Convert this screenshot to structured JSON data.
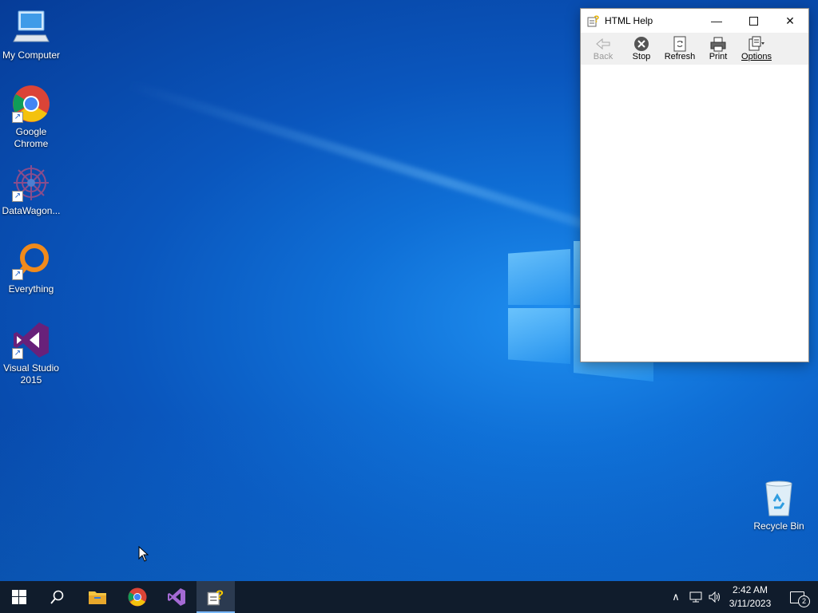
{
  "desktop": {
    "icons": [
      {
        "label": "My Computer",
        "icon": "computer-icon"
      },
      {
        "label": "Google Chrome",
        "icon": "chrome-icon"
      },
      {
        "label": "DataWagon...",
        "icon": "datawagon-icon"
      },
      {
        "label": "Everything",
        "icon": "everything-search-icon"
      },
      {
        "label": "Visual Studio 2015",
        "icon": "visual-studio-icon"
      },
      {
        "label": "Recycle Bin",
        "icon": "recycle-bin-icon"
      }
    ]
  },
  "window": {
    "title": "HTML Help",
    "toolbar": [
      {
        "label": "Back",
        "icon": "back-arrow-icon",
        "enabled": false
      },
      {
        "label": "Stop",
        "icon": "stop-icon",
        "enabled": true
      },
      {
        "label": "Refresh",
        "icon": "refresh-icon",
        "enabled": true
      },
      {
        "label": "Print",
        "icon": "printer-icon",
        "enabled": true
      },
      {
        "label": "Options",
        "icon": "options-icon",
        "enabled": true
      }
    ]
  },
  "taskbar": {
    "apps": [
      "start-icon",
      "search-icon",
      "file-explorer-icon",
      "chrome-icon",
      "visual-studio-icon",
      "html-help-icon"
    ],
    "clock": {
      "time": "2:42 AM",
      "date": "3/11/2023"
    },
    "notifications": "2"
  },
  "colors": {
    "accent": "#0a6cd6",
    "taskbar": "#101c2c"
  }
}
